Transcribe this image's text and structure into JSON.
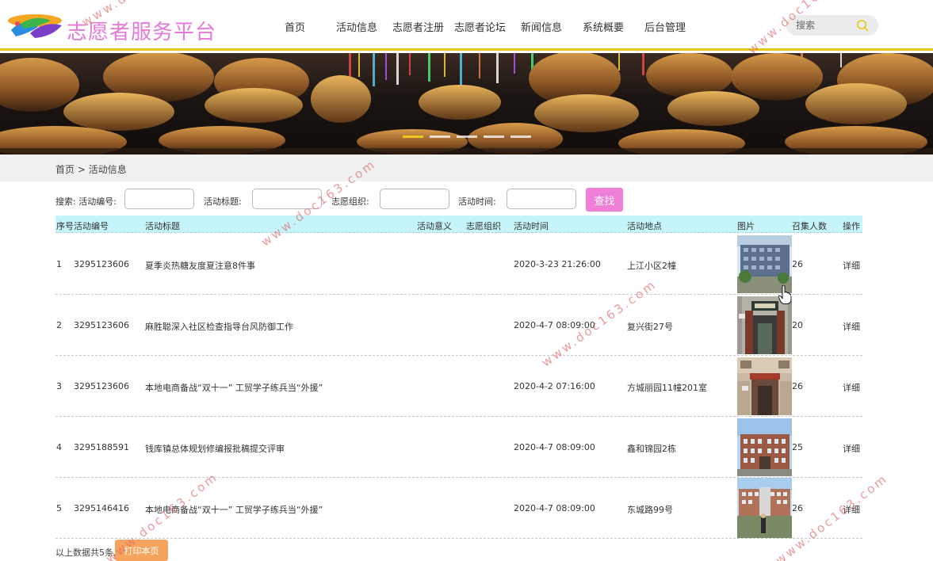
{
  "brand": {
    "name": "志愿者服务平台"
  },
  "nav": {
    "items": [
      {
        "label": "首页"
      },
      {
        "label": "活动信息"
      },
      {
        "label": "志愿者注册"
      },
      {
        "label": "志愿者论坛"
      },
      {
        "label": "新闻信息"
      },
      {
        "label": "系统概要"
      },
      {
        "label": "后台管理"
      }
    ]
  },
  "search": {
    "placeholder": "搜索"
  },
  "breadcrumb": {
    "home": "首页",
    "separator": ">",
    "current": "活动信息"
  },
  "filters": {
    "prefix": "搜索:",
    "activity_no_label": "活动编号:",
    "title_label": "活动标题:",
    "org_label": "志愿组织:",
    "time_label": "活动时间:",
    "submit_label": "查找"
  },
  "table": {
    "columns": [
      "序号",
      "活动编号",
      "活动标题",
      "活动意义",
      "志愿组织",
      "活动时间",
      "活动地点",
      "图片",
      "召集人数",
      "操作"
    ],
    "rows": [
      {
        "index": "1",
        "no": "3295123606",
        "title": "夏季炎热糖友度夏注意8件事",
        "meaning": "",
        "org": "",
        "time": "2020-3-23 21:26:00",
        "place": "上江小区2幢",
        "photo": "building-photo",
        "count": "26",
        "action": "详细"
      },
      {
        "index": "2",
        "no": "3295123606",
        "title": "麻胜聪深入社区检查指导台风防御工作",
        "meaning": "",
        "org": "",
        "time": "2020-4-7 08:09:00",
        "place": "复兴街27号",
        "photo": "gate-photo",
        "count": "20",
        "action": "详细"
      },
      {
        "index": "3",
        "no": "3295123606",
        "title": "本地电商备战“双十一” 工贸学子练兵当“外援”",
        "meaning": "",
        "org": "",
        "time": "2020-4-2 07:16:00",
        "place": "方城丽园11幢201室",
        "photo": "entrance-photo",
        "count": "26",
        "action": "详细"
      },
      {
        "index": "4",
        "no": "3295188591",
        "title": "钱库镇总体规划修编报批稿提交评审",
        "meaning": "",
        "org": "",
        "time": "2020-4-7 08:09:00",
        "place": "鑫和锦园2栋",
        "photo": "office-photo",
        "count": "25",
        "action": "详细"
      },
      {
        "index": "5",
        "no": "3295146416",
        "title": "本地电商备战“双十一” 工贸学子练兵当“外援”",
        "meaning": "",
        "org": "",
        "time": "2020-4-7 08:09:00",
        "place": "东城路99号",
        "photo": "campus-photo",
        "count": "26",
        "action": "详细"
      }
    ]
  },
  "footer": {
    "summary": "以上数据共5条,",
    "print_label": "打印本页"
  },
  "watermark": {
    "text": "www.doc163.com"
  },
  "colors": {
    "brand": "#e57ad9",
    "accent": "#e8c81a",
    "table_header": "#c5f4fb",
    "find_button": "#f07fd7",
    "print_button": "#f6a45d"
  }
}
